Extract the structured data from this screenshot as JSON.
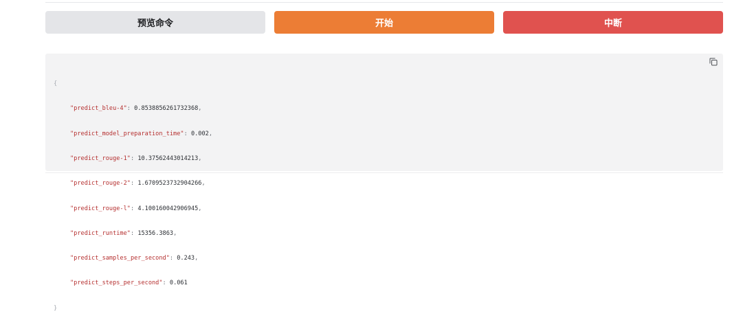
{
  "buttons": {
    "preview_label": "预览命令",
    "start_label": "开始",
    "stop_label": "中断"
  },
  "colors": {
    "preview_bg": "#e4e5e8",
    "start_bg": "#ec7d35",
    "stop_bg": "#e0524f",
    "json_key": "#b52f2f",
    "panel_bg": "#f3f3f4"
  },
  "json_output": {
    "open_brace": "{",
    "close_brace": "}",
    "entries": [
      {
        "key": "\"predict_bleu-4\"",
        "value": "0.8538856261732368",
        "comma": ","
      },
      {
        "key": "\"predict_model_preparation_time\"",
        "value": "0.002",
        "comma": ","
      },
      {
        "key": "\"predict_rouge-1\"",
        "value": "10.37562443014213",
        "comma": ","
      },
      {
        "key": "\"predict_rouge-2\"",
        "value": "1.6709523732904266",
        "comma": ","
      },
      {
        "key": "\"predict_rouge-l\"",
        "value": "4.100160042906945",
        "comma": ","
      },
      {
        "key": "\"predict_runtime\"",
        "value": "15356.3863",
        "comma": ","
      },
      {
        "key": "\"predict_samples_per_second\"",
        "value": "0.243",
        "comma": ","
      },
      {
        "key": "\"predict_steps_per_second\"",
        "value": "0.061",
        "comma": ""
      }
    ],
    "copy_icon": "copy-icon"
  }
}
